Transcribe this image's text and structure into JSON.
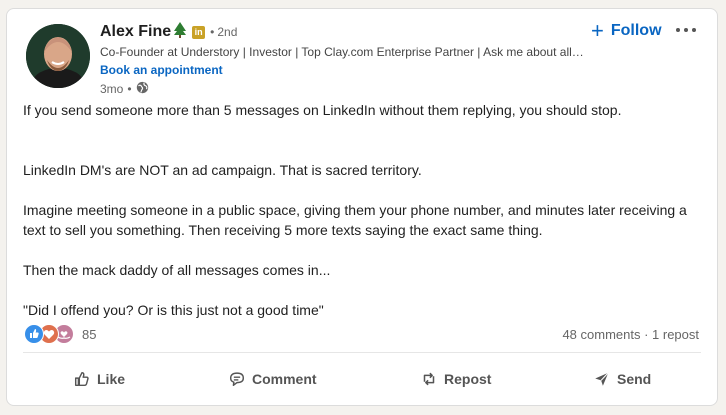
{
  "post": {
    "author": {
      "name": "Alex Fine",
      "badge": "in",
      "degree": "2nd",
      "headline": "Co-Founder at Understory | Investor | Top Clay.com Enterprise Partner | Ask me about allb...",
      "appointment_link": "Book an appointment",
      "time": "3mo"
    },
    "follow_label": "Follow",
    "body": {
      "p1": "If you send someone more than 5 messages on LinkedIn without them replying, you should stop.",
      "p2": "LinkedIn DM's are NOT an ad campaign. That is sacred territory.",
      "p3": "Imagine meeting someone in a public space, giving them your phone number, and minutes later receiving a text to sell you something. Then receiving 5 more texts saying the exact same thing.",
      "p4": "Then the mack daddy of all messages comes in...",
      "p5": "\"Did I offend you? Or is this just not a good time\""
    },
    "reactions": {
      "count": "85",
      "icons": [
        "like-icon",
        "love-icon",
        "support-icon"
      ]
    },
    "stats": "48 comments · 1 repost",
    "actions": {
      "like": "Like",
      "comment": "Comment",
      "repost": "Repost",
      "send": "Send"
    }
  },
  "colors": {
    "accent": "#0a66c2",
    "like": "#378fe9",
    "love": "#df704d",
    "support": "#c37d9c"
  }
}
